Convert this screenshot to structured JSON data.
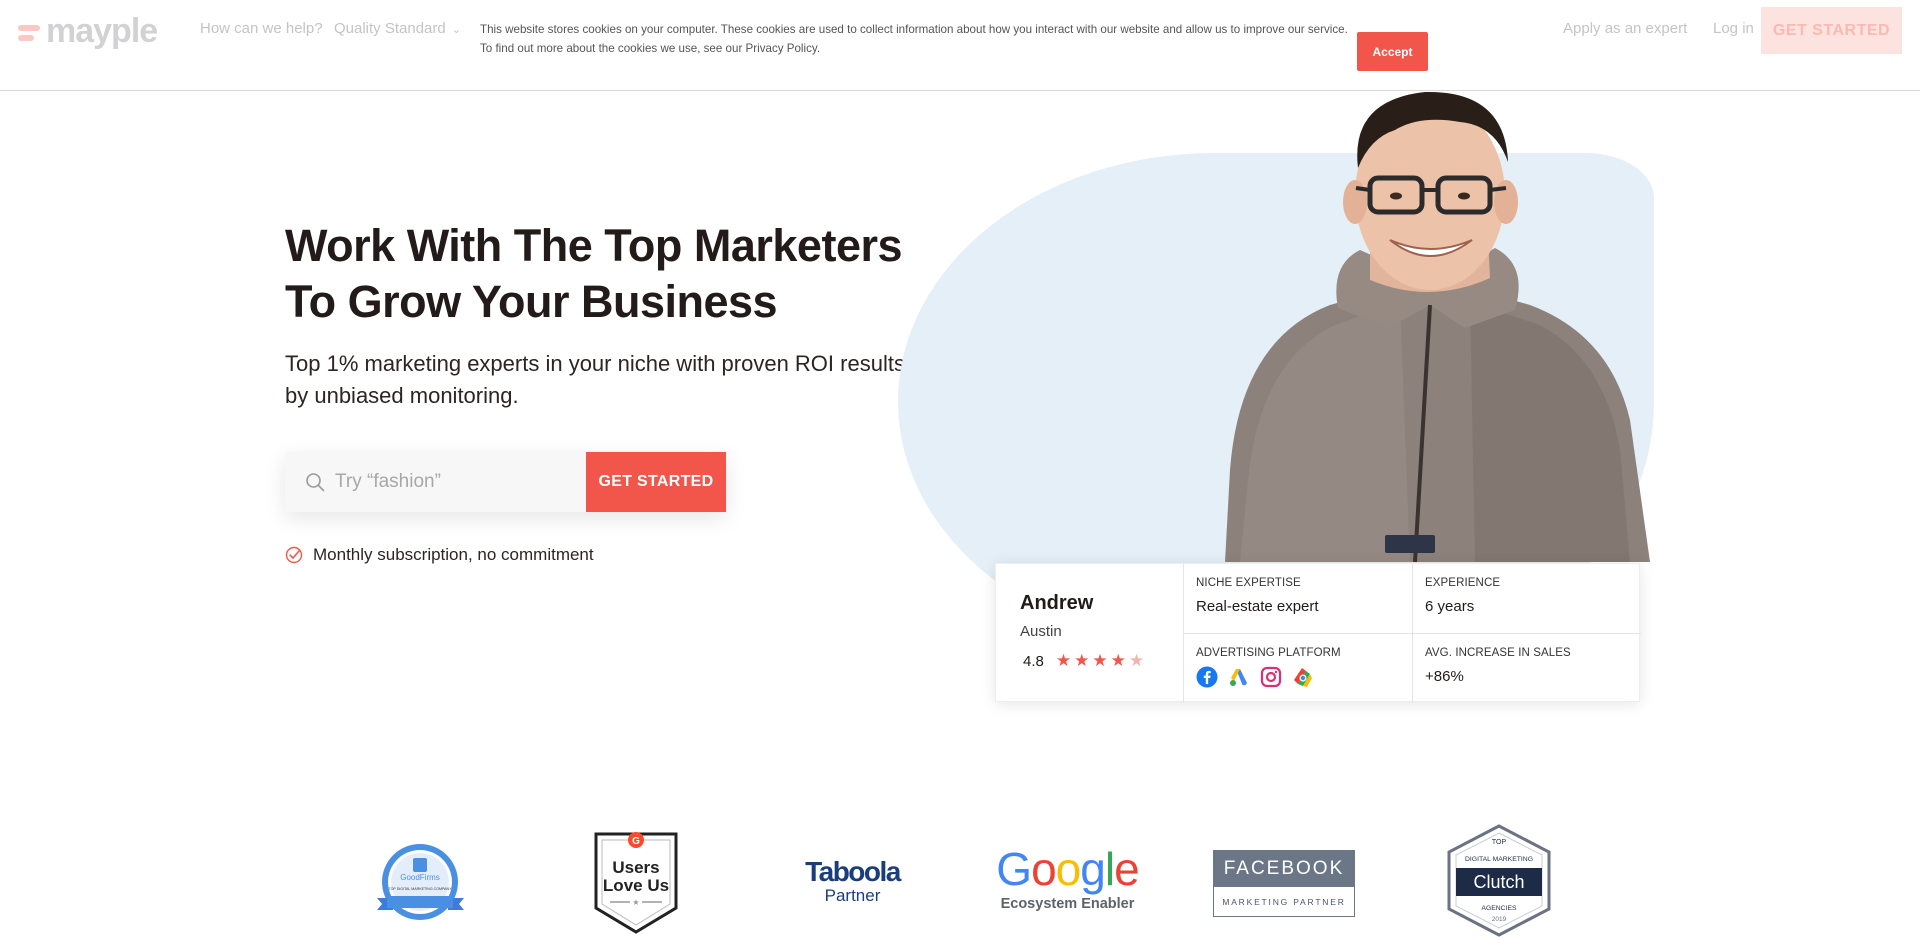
{
  "header": {
    "logo_text": "mayple",
    "nav": {
      "how": "How can we help?",
      "quality": "Quality Standard",
      "apply": "Apply as an expert",
      "login": "Log in"
    },
    "cta": "GET STARTED"
  },
  "cookie_banner": {
    "text": "This website stores cookies on your computer. These cookies are used to collect information about how you interact with our website and allow us to improve our service. To find out more about the cookies we use, see our Privacy Policy.",
    "accept": "Accept"
  },
  "hero": {
    "title_line1": "Work With The Top Marketers",
    "title_line2": "To Grow Your Business",
    "subtitle": "Top 1% marketing experts in your niche with proven ROI results, backed by unbiased monitoring.",
    "search_placeholder": "Try “fashion”",
    "search_button": "GET STARTED",
    "commitment": "Monthly subscription, no commitment"
  },
  "expert_card": {
    "name": "Andrew",
    "city": "Austin",
    "rating": "4.8",
    "stars": 4.8,
    "niche_label": "NICHE EXPERTISE",
    "niche_value": "Real-estate expert",
    "experience_label": "EXPERIENCE",
    "experience_value": "6 years",
    "platform_label": "ADVERTISING PLATFORM",
    "platforms": [
      "facebook-icon",
      "google-ads-icon",
      "instagram-icon",
      "google-marketing-icon"
    ],
    "sales_label": "AVG. INCREASE IN SALES",
    "sales_value": "+86%"
  },
  "badges": {
    "goodfirms": "GoodFirms",
    "goodfirms_sub": "TOP DIGITAL MARKETING COMPANY",
    "g2_line1": "Users",
    "g2_line2": "Love Us",
    "taboola": "Taboola",
    "taboola_sub": "Partner",
    "google": "Google",
    "google_sub": "Ecosystem Enabler",
    "facebook": "FACEBOOK",
    "facebook_sub": "MARKETING PARTNER",
    "clutch_top": "TOP",
    "clutch_cat": "DIGITAL MARKETING",
    "clutch": "Clutch",
    "clutch_agencies": "AGENCIES",
    "clutch_year": "2019"
  },
  "colors": {
    "accent": "#f2564a",
    "blob": "#e4eff7",
    "text": "#231a1a"
  }
}
